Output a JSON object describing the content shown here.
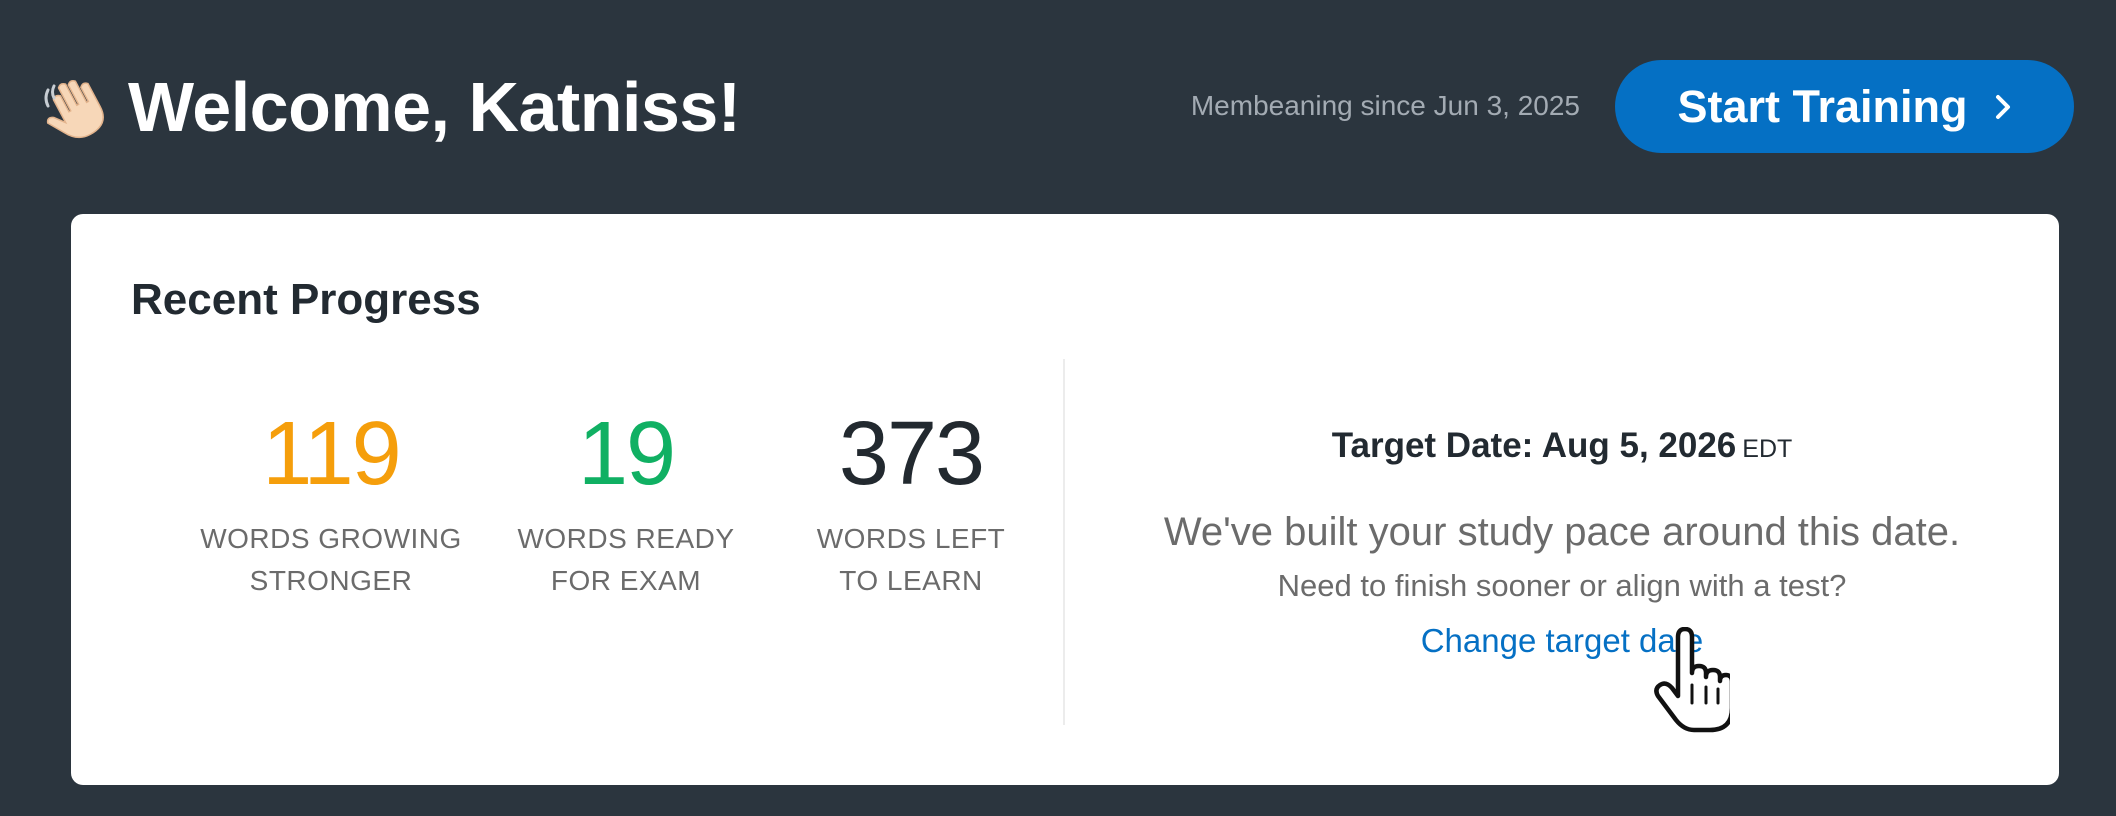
{
  "header": {
    "wave_icon": "waving-hand-emoji",
    "welcome_text": "Welcome, Katniss!",
    "member_since": "Membeaning since Jun 3, 2025",
    "start_button_label": "Start Training",
    "start_button_icon": "chevron-right-icon",
    "colors": {
      "background": "#2b353e",
      "button": "#0570c4"
    }
  },
  "progress": {
    "title": "Recent Progress",
    "stats": [
      {
        "value": "119",
        "label_line1": "WORDS GROWING",
        "label_line2": "STRONGER",
        "color": "#f59e0b"
      },
      {
        "value": "19",
        "label_line1": "WORDS READY",
        "label_line2": "FOR EXAM",
        "color": "#10b063"
      },
      {
        "value": "373",
        "label_line1": "WORDS LEFT",
        "label_line2": "TO LEARN",
        "color": "#22292f"
      }
    ],
    "target": {
      "date_label": "Target Date: Aug 5, 2026",
      "timezone": "EDT",
      "pace_message": "We've built your study pace around this date.",
      "finish_message": "Need to finish sooner or align with a test?",
      "change_link": "Change target date",
      "link_color": "#0570c4"
    }
  },
  "cursor": {
    "icon": "hand-pointer-cursor-icon"
  }
}
